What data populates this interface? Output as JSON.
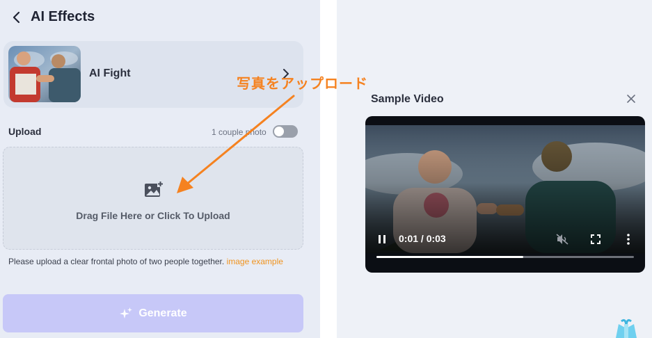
{
  "header": {
    "title": "AI Effects"
  },
  "effect_card": {
    "name": "AI Fight"
  },
  "upload": {
    "label": "Upload",
    "couple_photo_label": "1 couple photo",
    "couple_photo_enabled": false,
    "dropzone_text": "Drag File Here or Click To Upload",
    "hint_text": "Please upload a clear frontal photo of two people together.",
    "hint_link": "image example"
  },
  "generate": {
    "label": "Generate"
  },
  "sample": {
    "title": "Sample Video",
    "time": "0:01 / 0:03",
    "progress": 0.57
  },
  "annotation": {
    "text": "写真をアップロード"
  },
  "colors": {
    "accent_orange": "#f58220",
    "link_orange": "#f0931e",
    "generate_bg": "#c7c8f8"
  },
  "icons": [
    "chevron-left-icon",
    "chevron-right-icon",
    "add-image-icon",
    "sparkle-icon",
    "close-icon",
    "pause-icon",
    "mute-icon",
    "fullscreen-icon",
    "more-vertical-icon",
    "gift-icon"
  ]
}
